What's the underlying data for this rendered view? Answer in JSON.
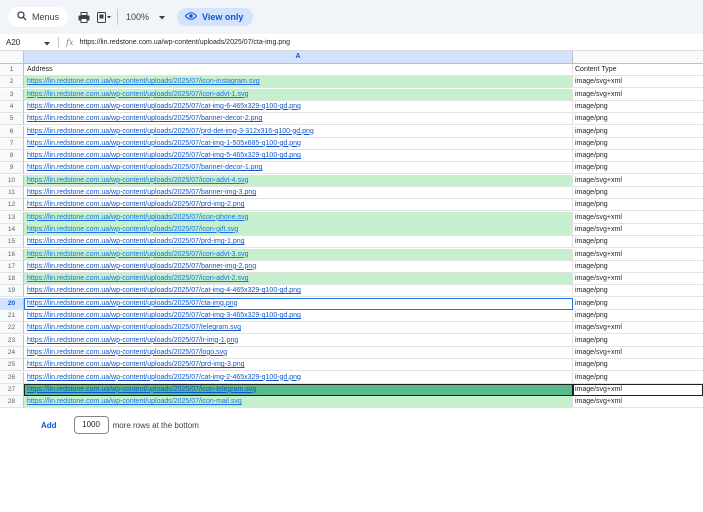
{
  "toolbar": {
    "menus_label": "Menus",
    "zoom_label": "100%",
    "view_only_label": "View only"
  },
  "formula_bar": {
    "cell_ref": "A20",
    "fx": "fx",
    "value": "https://lin.redstone.com.ua/wp-content/uploads/2025/07/cta-img.png"
  },
  "columns": {
    "a_letter": "A"
  },
  "rows": [
    {
      "num": "1",
      "address": "Address",
      "type": "Content Type"
    },
    {
      "num": "2",
      "address": "https://lin.redstone.com.ua/wp-content/uploads/2025/07/icon-instagram.svg",
      "type": "image/svg+xml"
    },
    {
      "num": "3",
      "address": "https://lin.redstone.com.ua/wp-content/uploads/2025/07/icon-advt-1.svg",
      "type": "image/svg+xml"
    },
    {
      "num": "4",
      "address": "https://lin.redstone.com.ua/wp-content/uploads/2025/07/cat-img-6-465x329-q100-gd.png",
      "type": "image/png"
    },
    {
      "num": "5",
      "address": "https://lin.redstone.com.ua/wp-content/uploads/2025/07/banner-decor-2.png",
      "type": "image/png"
    },
    {
      "num": "6",
      "address": "https://lin.redstone.com.ua/wp-content/uploads/2025/07/prd-det-img-3-312x316-q100-gd.png",
      "type": "image/png"
    },
    {
      "num": "7",
      "address": "https://lin.redstone.com.ua/wp-content/uploads/2025/07/cat-img-1-505x685-q100-gd.png",
      "type": "image/png"
    },
    {
      "num": "8",
      "address": "https://lin.redstone.com.ua/wp-content/uploads/2025/07/cat-img-5-465x329-q100-gd.png",
      "type": "image/png"
    },
    {
      "num": "9",
      "address": "https://lin.redstone.com.ua/wp-content/uploads/2025/07/banner-decor-1.png",
      "type": "image/png"
    },
    {
      "num": "10",
      "address": "https://lin.redstone.com.ua/wp-content/uploads/2025/07/icon-advt-4.svg",
      "type": "image/svg+xml"
    },
    {
      "num": "11",
      "address": "https://lin.redstone.com.ua/wp-content/uploads/2025/07/banner-img-3.png",
      "type": "image/png"
    },
    {
      "num": "12",
      "address": "https://lin.redstone.com.ua/wp-content/uploads/2025/07/prd-img-2.png",
      "type": "image/png"
    },
    {
      "num": "13",
      "address": "https://lin.redstone.com.ua/wp-content/uploads/2025/07/icon-phone.svg",
      "type": "image/svg+xml"
    },
    {
      "num": "14",
      "address": "https://lin.redstone.com.ua/wp-content/uploads/2025/07/icon-gift.svg",
      "type": "image/svg+xml"
    },
    {
      "num": "15",
      "address": "https://lin.redstone.com.ua/wp-content/uploads/2025/07/prd-img-1.png",
      "type": "image/png"
    },
    {
      "num": "16",
      "address": "https://lin.redstone.com.ua/wp-content/uploads/2025/07/icon-advt-3.svg",
      "type": "image/svg+xml"
    },
    {
      "num": "17",
      "address": "https://lin.redstone.com.ua/wp-content/uploads/2025/07/banner-img-2.png",
      "type": "image/png"
    },
    {
      "num": "18",
      "address": "https://lin.redstone.com.ua/wp-content/uploads/2025/07/icon-advt-2.svg",
      "type": "image/svg+xml"
    },
    {
      "num": "19",
      "address": "https://lin.redstone.com.ua/wp-content/uploads/2025/07/cat-img-4-465x329-q100-gd.png",
      "type": "image/png"
    },
    {
      "num": "20",
      "address": "https://lin.redstone.com.ua/wp-content/uploads/2025/07/cta-img.png",
      "type": "image/png"
    },
    {
      "num": "21",
      "address": "https://lin.redstone.com.ua/wp-content/uploads/2025/07/cat-img-3-465x329-q100-gd.png",
      "type": "image/png"
    },
    {
      "num": "22",
      "address": "https://lin.redstone.com.ua/wp-content/uploads/2025/07/telegram.svg",
      "type": "image/svg+xml"
    },
    {
      "num": "23",
      "address": "https://lin.redstone.com.ua/wp-content/uploads/2025/07/lr-img-1.png",
      "type": "image/png"
    },
    {
      "num": "24",
      "address": "https://lin.redstone.com.ua/wp-content/uploads/2025/07/logo.svg",
      "type": "image/svg+xml"
    },
    {
      "num": "25",
      "address": "https://lin.redstone.com.ua/wp-content/uploads/2025/07/prd-img-3.png",
      "type": "image/png"
    },
    {
      "num": "26",
      "address": "https://lin.redstone.com.ua/wp-content/uploads/2025/07/cat-img-2-465x329-q100-gd.png",
      "type": "image/png"
    },
    {
      "num": "27",
      "address": "https://lin.redstone.com.ua/wp-content/uploads/2025/07/icon-telegram.svg",
      "type": "image/svg+xml"
    },
    {
      "num": "28",
      "address": "https://lin.redstone.com.ua/wp-content/uploads/2025/07/icon-mail.svg",
      "type": "image/svg+xml"
    }
  ],
  "footer": {
    "add_label": "Add",
    "rows_count": "1000",
    "more_rows_text": "more rows at the bottom"
  },
  "colors": {
    "highlight_green": "#c6efce",
    "selected_green": "#57bb8a",
    "accent_blue": "#0b57d0",
    "link_blue": "#1155cc"
  }
}
